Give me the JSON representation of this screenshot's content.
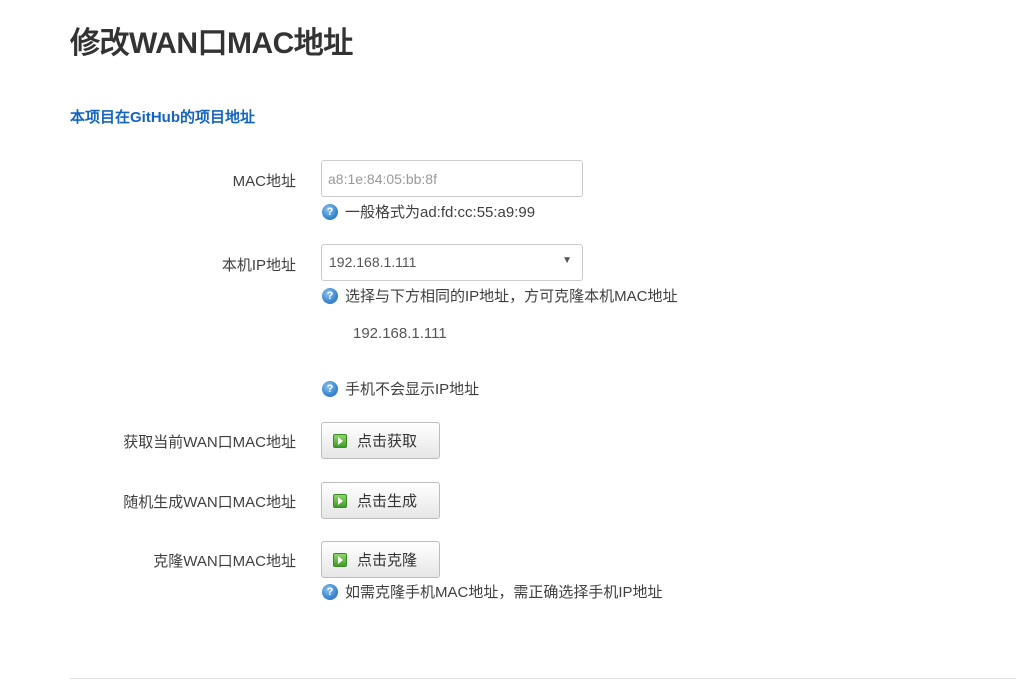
{
  "page": {
    "title": "修改WAN口MAC地址",
    "github_link": "本项目在GitHub的项目地址"
  },
  "mac_field": {
    "label": "MAC地址",
    "placeholder": "a8:1e:84:05:bb:8f",
    "value": "",
    "hint": "一般格式为ad:fd:cc:55:a9:99"
  },
  "ip_field": {
    "label": "本机IP地址",
    "selected": "192.168.1.111",
    "hint": "选择与下方相同的IP地址，方可克隆本机MAC地址",
    "detected_ip": "192.168.1.111",
    "hint2": "手机不会显示IP地址"
  },
  "get_current": {
    "label": "获取当前WAN口MAC地址",
    "button": "点击获取"
  },
  "random_generate": {
    "label": "随机生成WAN口MAC地址",
    "button": "点击生成"
  },
  "clone": {
    "label": "克隆WAN口MAC地址",
    "button": "点击克隆",
    "hint": "如需克隆手机MAC地址，需正确选择手机IP地址"
  },
  "icons": {
    "help": "help-icon",
    "play": "play-icon"
  },
  "colors": {
    "link": "#1565c0",
    "help_icon": "#3a86cf",
    "play_icon": "#4caf50"
  }
}
